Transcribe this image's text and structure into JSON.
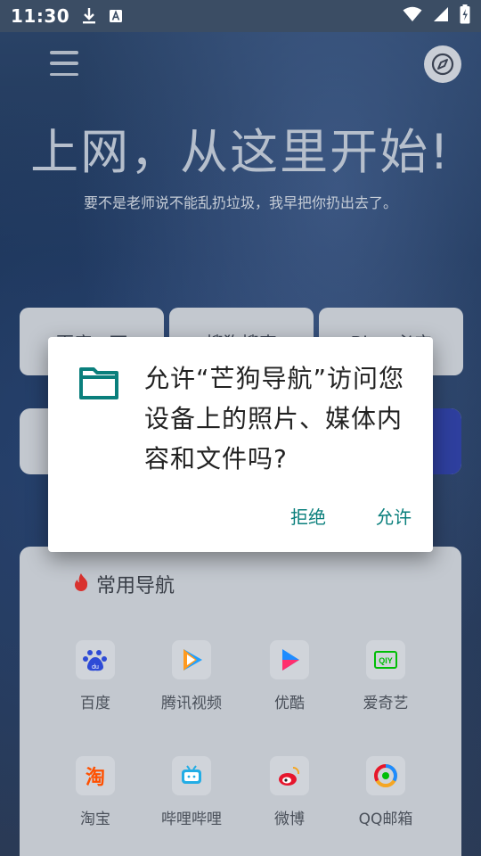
{
  "status_bar": {
    "time": "11:30",
    "icons": [
      "download-icon",
      "a-notification-icon",
      "wifi-icon",
      "signal-icon",
      "battery-charging-icon"
    ]
  },
  "header": {
    "menu_icon": "hamburger-menu-icon",
    "compass_icon": "compass-icon"
  },
  "hero": {
    "title": "上网，从这里开始!",
    "subtitle": "要不是老师说不能乱扔垃圾，我早把你扔出去了。"
  },
  "search_engines": {
    "items": [
      {
        "label": "百度一下"
      },
      {
        "label": "搜狗搜索"
      },
      {
        "label": "Bing 必应"
      }
    ]
  },
  "common_nav": {
    "title": "常用导航",
    "title_icon": "flame-icon",
    "items": [
      {
        "label": "百度",
        "icon": "baidu-paw-icon",
        "color": "#2e4bd6"
      },
      {
        "label": "腾讯视频",
        "icon": "tencent-video-play-icon",
        "color": "#20a0ff"
      },
      {
        "label": "优酷",
        "icon": "youku-play-icon",
        "color": "#1e8cff"
      },
      {
        "label": "爱奇艺",
        "icon": "iqiyi-icon",
        "color": "#00be06"
      },
      {
        "label": "淘宝",
        "icon": "taobao-icon",
        "color": "#ff5000"
      },
      {
        "label": "哔哩哔哩",
        "icon": "bilibili-tv-icon",
        "color": "#23ade5"
      },
      {
        "label": "微博",
        "icon": "weibo-icon",
        "color": "#e6162d"
      },
      {
        "label": "QQ邮箱",
        "icon": "qq-mail-icon",
        "color": "#f5a623"
      }
    ]
  },
  "dialog": {
    "message": "允许“芒狗导航”访问您设备上的照片、媒体内容和文件吗?",
    "icon": "folder-icon",
    "accent": "#0a7f7c",
    "deny_label": "拒绝",
    "allow_label": "允许"
  }
}
